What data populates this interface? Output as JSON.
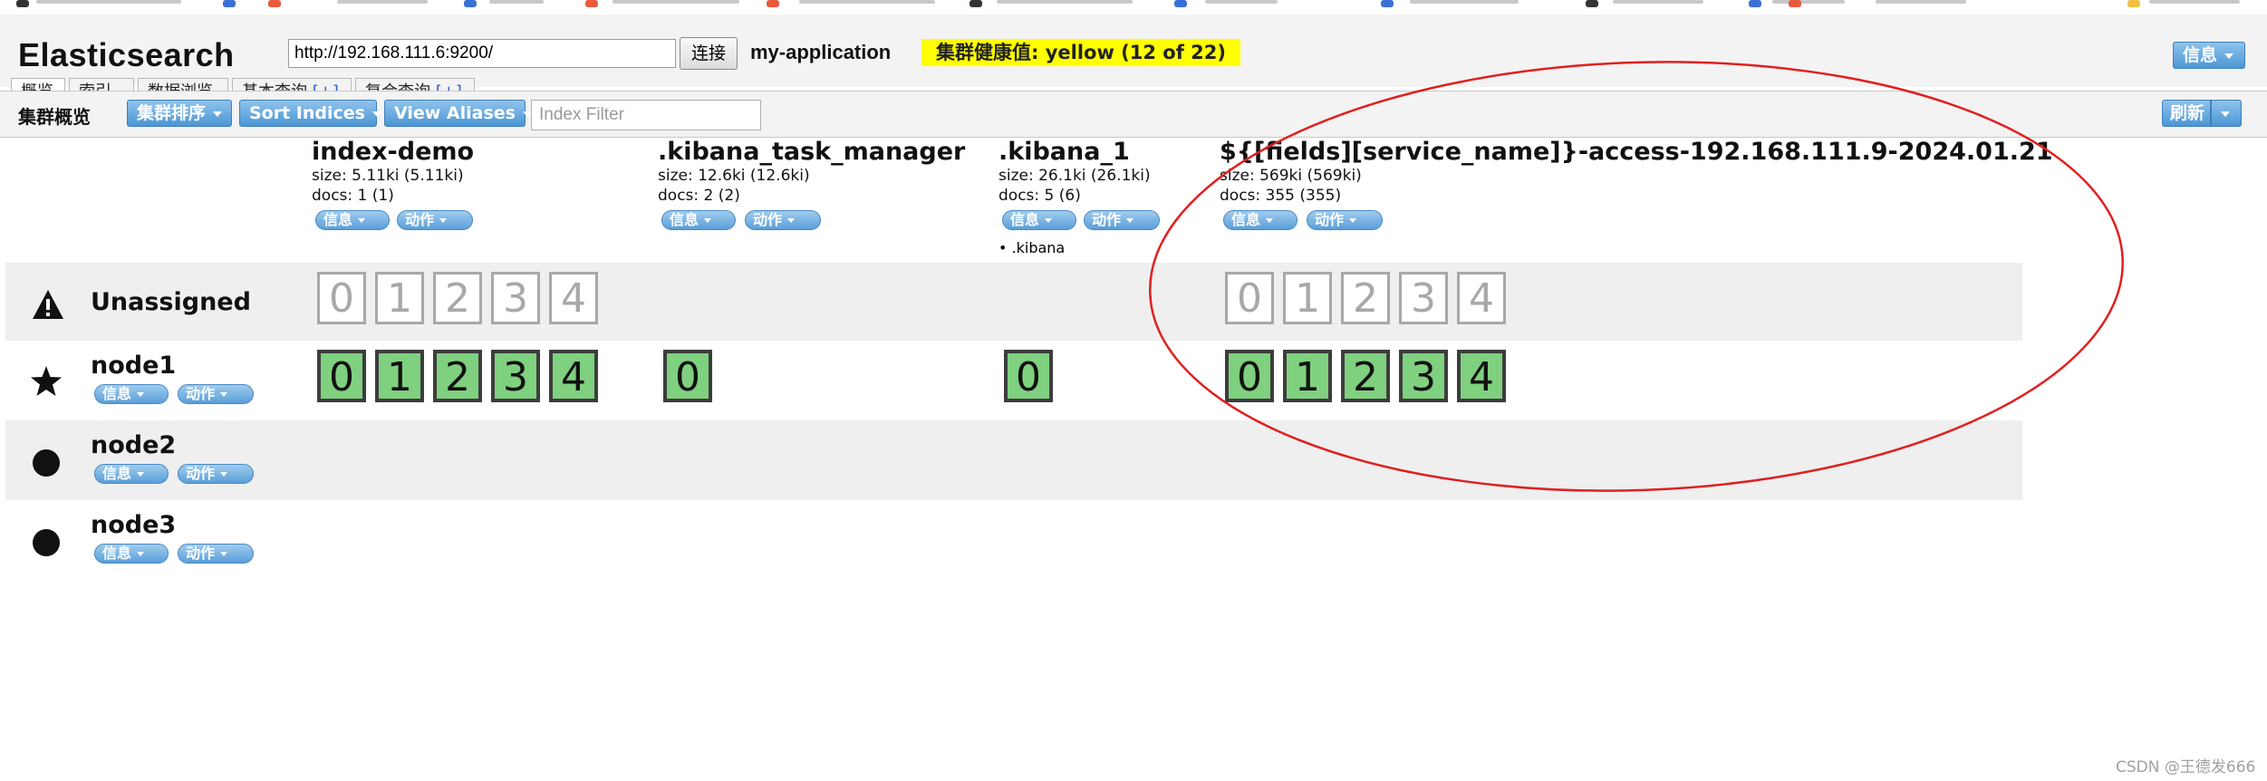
{
  "app": {
    "title": "Elasticsearch",
    "url": "http://192.168.111.6:9200/",
    "connect_label": "连接",
    "cluster_name": "my-application",
    "health": "集群健康值: yellow (12 of 22)",
    "info_label": "信息"
  },
  "tabs": [
    {
      "label": "概览",
      "active": true
    },
    {
      "label": "索引",
      "active": false
    },
    {
      "label": "数据浏览",
      "active": false
    },
    {
      "label": "基本查询",
      "plus": "[+]",
      "active": false
    },
    {
      "label": "复合查询",
      "plus": "[+]",
      "active": false
    }
  ],
  "toolbar": {
    "title": "集群概览",
    "sort_cluster": "集群排序",
    "sort_indices": "Sort Indices",
    "view_aliases": "View Aliases",
    "index_filter_placeholder": "Index Filter",
    "refresh": "刷新"
  },
  "indices": [
    {
      "name": "index-demo",
      "size": "size: 5.11ki (5.11ki)",
      "docs": "docs: 1 (1)",
      "info": "信息",
      "action": "动作"
    },
    {
      "name": ".kibana_task_manager",
      "size": "size: 12.6ki (12.6ki)",
      "docs": "docs: 2 (2)",
      "info": "信息",
      "action": "动作"
    },
    {
      "name": ".kibana_1",
      "size": "size: 26.1ki (26.1ki)",
      "docs": "docs: 5 (6)",
      "info": "信息",
      "action": "动作",
      "alias": ".kibana"
    },
    {
      "name": "${[fields][service_name]}-access-192.168.111.9-2024.01.21",
      "size": "size: 569ki (569ki)",
      "docs": "docs: 355 (355)",
      "info": "信息",
      "action": "动作"
    }
  ],
  "rows": [
    {
      "label": "Unassigned",
      "icon": "warning-icon"
    },
    {
      "label": "node1",
      "icon": "star-icon",
      "info": "信息",
      "action": "动作"
    },
    {
      "label": "node2",
      "icon": "circle-icon",
      "info": "信息",
      "action": "动作"
    },
    {
      "label": "node3",
      "icon": "circle-icon",
      "info": "信息",
      "action": "动作"
    }
  ],
  "shards": {
    "unassigned_index_demo": [
      "0",
      "1",
      "2",
      "3",
      "4"
    ],
    "unassigned_service_index": [
      "0",
      "1",
      "2",
      "3",
      "4"
    ],
    "node1_index_demo": [
      "0",
      "1",
      "2",
      "3",
      "4"
    ],
    "node1_kibana_task_manager": [
      "0"
    ],
    "node1_kibana_1": [
      "0"
    ],
    "node1_service_index": [
      "0",
      "1",
      "2",
      "3",
      "4"
    ]
  },
  "watermark": "CSDN @王德发666",
  "colors": {
    "health_yellow": "#ffff00",
    "shard_started": "#7fd07f",
    "annotation_circle": "#e02020",
    "button_blue": "#4c96d4"
  }
}
